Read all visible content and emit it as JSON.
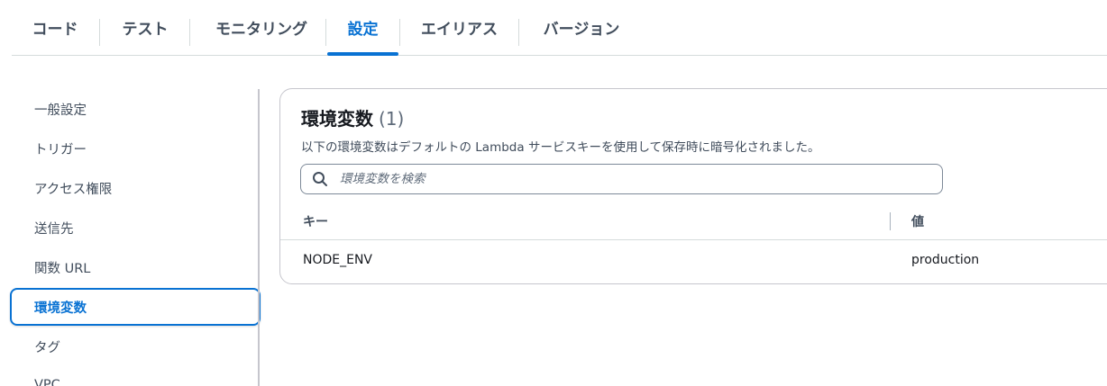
{
  "tabs": [
    {
      "label": "コード"
    },
    {
      "label": "テスト"
    },
    {
      "label": "モニタリング"
    },
    {
      "label": "設定"
    },
    {
      "label": "エイリアス"
    },
    {
      "label": "バージョン"
    }
  ],
  "active_tab": "設定",
  "sidenav": {
    "items": [
      {
        "label": "一般設定"
      },
      {
        "label": "トリガー"
      },
      {
        "label": "アクセス権限"
      },
      {
        "label": "送信先"
      },
      {
        "label": "関数 URL"
      },
      {
        "label": "環境変数"
      },
      {
        "label": "タグ"
      },
      {
        "label": "VPC"
      }
    ],
    "active": "環境変数"
  },
  "panel": {
    "title": "環境変数",
    "count": "(1)",
    "description": "以下の環境変数はデフォルトの Lambda サービスキーを使用して保存時に暗号化されました。",
    "search_placeholder": "環境変数を検索",
    "search_value": "",
    "table": {
      "columns": [
        "キー",
        "値"
      ],
      "rows": [
        {
          "key": "NODE_ENV",
          "value": "production"
        }
      ]
    }
  },
  "colors": {
    "accent": "#0972d3",
    "text": "#16191f",
    "muted": "#414d5c",
    "border": "#c6c6cd"
  }
}
